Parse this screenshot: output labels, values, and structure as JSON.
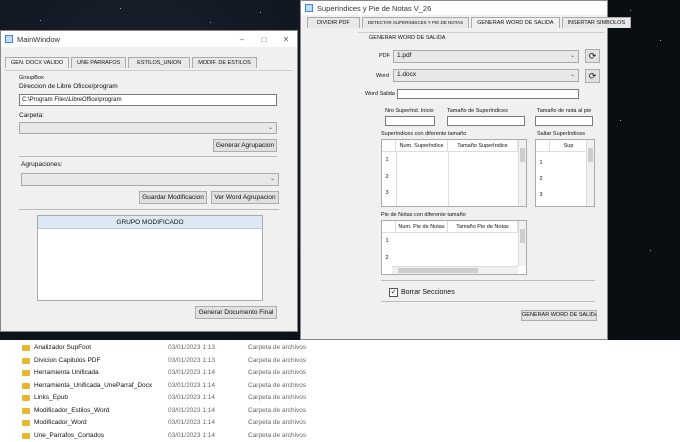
{
  "main_window": {
    "title": "MainWindow",
    "controls": [
      "–",
      "□",
      "✕"
    ],
    "tabs": [
      "GEN. DOCX VALIDO",
      "UNE PARRAFOS",
      "ESTILOS_UNION",
      "MODIF. DE ESTILOS"
    ],
    "groupbox_label": "GroupBox",
    "dir_label": "Direccion de Libre Oficce/program",
    "dir_value": "C:\\Program Files\\LibreOffice\\program",
    "carpeta_label": "Carpeta:",
    "generar_agrupacion": "Generar Agrupacion",
    "agrupaciones_label": "Agrupaciones:",
    "guardar_modificacion": "Guardar Modificacion",
    "ver_word_agrupacion": "Ver Word Agrupacion",
    "grupo_header": "GRUPO MODIFICADO",
    "generar_documento_final": "Generar Documento Final"
  },
  "sup_window": {
    "title": "SuperIndices y Pie de Notas V_26",
    "tabs": [
      "DIVIDIR PDF",
      "DETECTAR SUPERINDICES Y PIE DE NOTAS",
      "GENERAR WORD DE SALIDA",
      "INSERTAR SIMBOLOS"
    ],
    "section_label": "GENERAR WORD DE SALIDA",
    "pdf_label": "PDF",
    "pdf_value": "1.pdf",
    "word_label": "Word",
    "word_value": "1.docx",
    "word_salida_label": "Word Salida",
    "col1_label": "Nro SuperInd. Inicio",
    "col2_label": "Tamaño de SuperIndices",
    "col3_label": "Tamaño de nota al pie",
    "super_diff_label": "SuperIndices con diferente tamaño",
    "super_diff_headers": [
      "Num. SuperIndice",
      "Tamaño SuperIndice"
    ],
    "rows": [
      "1",
      "2",
      "3"
    ],
    "saltar_label": "Saltar SuperIndices",
    "saltar_header": "Sup",
    "pie_label": "Pie de Notas con diferente tamaño",
    "pie_headers": [
      "Num. Pie de Notas",
      "Tamaño Pie de Notas"
    ],
    "pie_rows": [
      "1",
      "2"
    ],
    "borrar_label": "Borrar Secciones",
    "borrar_checked": true,
    "generar_word_salida": "GENERAR WORD DE SALIDA"
  },
  "explorer": {
    "rows": [
      {
        "name": "Analizador SupFoot",
        "date": "03/01/2023 1:13",
        "type": "Carpeta de archivos"
      },
      {
        "name": "Divicion Capitulos PDF",
        "date": "03/01/2023 1:13",
        "type": "Carpeta de archivos"
      },
      {
        "name": "Herramienta Unificada",
        "date": "03/01/2023 1:14",
        "type": "Carpeta de archivos"
      },
      {
        "name": "Herramienta_Unificada_UneParraf_Docx",
        "date": "03/01/2023 1:14",
        "type": "Carpeta de archivos"
      },
      {
        "name": "Links_Epub",
        "date": "03/01/2023 1:14",
        "type": "Carpeta de archivos"
      },
      {
        "name": "Modificador_Estilos_Word",
        "date": "03/01/2023 1:14",
        "type": "Carpeta de archivos"
      },
      {
        "name": "Modificador_Word",
        "date": "03/01/2023 1:14",
        "type": "Carpeta de archivos"
      },
      {
        "name": "Une_Parrafos_Cortados",
        "date": "03/01/2023 1:14",
        "type": "Carpeta de archivos"
      }
    ]
  }
}
